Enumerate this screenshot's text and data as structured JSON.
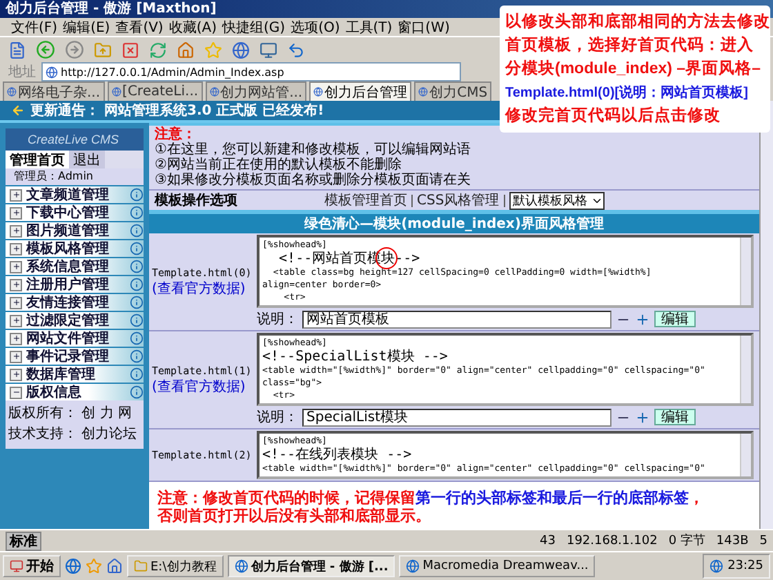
{
  "window": {
    "title": "创力后台管理 - 傲游 [Maxthon]"
  },
  "menu": [
    "文件(F)",
    "编辑(E)",
    "查看(V)",
    "收藏(A)",
    "快捷组(G)",
    "选项(O)",
    "工具(T)",
    "窗口(W)"
  ],
  "address": {
    "label": "地址",
    "value": "http://127.0.0.1/Admin/Admin_Index.asp"
  },
  "tabs": [
    {
      "label": "网络电子杂...",
      "selected": false
    },
    {
      "label": "[CreateLi...",
      "selected": false
    },
    {
      "label": "创力网站管...",
      "selected": false
    },
    {
      "label": "创力后台管理",
      "selected": true
    },
    {
      "label": "创力CMS",
      "selected": false
    }
  ],
  "banner": "更新通告： 网站管理系统3.0 正式版 已经发布!",
  "sidebar": {
    "logo": "CreateLive CMS",
    "tabs": [
      {
        "label": "管理首页",
        "selected": true
      },
      {
        "label": "退出",
        "selected": false
      }
    ],
    "admin": "管理员：Admin",
    "items": [
      {
        "label": "文章频道管理",
        "expanded": false
      },
      {
        "label": "下载中心管理",
        "expanded": false
      },
      {
        "label": "图片频道管理",
        "expanded": false
      },
      {
        "label": "模板风格管理",
        "expanded": false
      },
      {
        "label": "系统信息管理",
        "expanded": false
      },
      {
        "label": "注册用户管理",
        "expanded": false
      },
      {
        "label": "友情连接管理",
        "expanded": false
      },
      {
        "label": "过滤限定管理",
        "expanded": false
      },
      {
        "label": "网站文件管理",
        "expanded": false
      },
      {
        "label": "事件记录管理",
        "expanded": false
      },
      {
        "label": "数据库管理",
        "expanded": false
      },
      {
        "label": "版权信息",
        "expanded": true
      }
    ],
    "footer": [
      "版权所有： 创 力 网",
      "技术支持： 创力论坛"
    ]
  },
  "notice": {
    "title": "注意：",
    "lines": [
      "①在这里，您可以新建和修改模板，可以编辑网站语",
      "②网站当前正在使用的默认模板不能删除",
      "③如果修改分模板页面名称或删除分模板页面请在关"
    ]
  },
  "options": {
    "label": "模板操作选项",
    "links": [
      "模板管理首页",
      "CSS风格管理"
    ],
    "select": "默认模板风格"
  },
  "panel_title": "绿色清心—模块(module_index)界面风格管理",
  "templates": [
    {
      "name": "Template.html(0)",
      "link": "(查看官方数据)",
      "code": [
        "[%showhead%]",
        "  <!--网站首页模块-->",
        "  <table class=bg height=127 cellSpacing=0 cellPadding=0 width=[%width%]",
        "align=center border=0>",
        "    <tr>"
      ],
      "desc_label": "说明：",
      "desc": "网站首页模板",
      "button": "编辑"
    },
    {
      "name": "Template.html(1)",
      "link": "(查看官方数据)",
      "code": [
        "[%showhead%]",
        "<!--SpecialList模块 -->",
        "<table width=\"[%width%]\" border=\"0\" align=\"center\" cellpadding=\"0\" cellspacing=\"0\"",
        "class=\"bg\">",
        "  <tr>"
      ],
      "desc_label": "说明：",
      "desc": "SpecialList模块",
      "button": "编辑"
    },
    {
      "name": "Template.html(2)",
      "code": [
        "[%showhead%]",
        "<!--在线列表模块 -->",
        "<table width=\"[%width%]\" border=\"0\" align=\"center\" cellpadding=\"0\" cellspacing=\"0\""
      ]
    }
  ],
  "callout": [
    {
      "text": "以修改头部和底部相同的方法去修改",
      "highlight": false
    },
    {
      "text": "首页模板，选择好首页代码：进入",
      "highlight": false
    },
    {
      "text": "分模块(module_index) –界面风格–",
      "highlight": false
    },
    {
      "text": "Template.html(0)[说明：网站首页模板]",
      "highlight": true
    },
    {
      "text": "修改完首页代码以后点击修改",
      "highlight": false
    }
  ],
  "note": [
    [
      {
        "text": "注意：修改首页代码的时候，记得保留",
        "highlight": false
      },
      {
        "text": "第一行的头部标签和最后一行的底部标签",
        "highlight": true
      },
      {
        "text": "，",
        "highlight": false
      }
    ],
    [
      {
        "text": "否则首页打开以后没有头部和底部显示。",
        "highlight": false
      }
    ]
  ],
  "status_bar": {
    "mode": "标准",
    "items": [
      "43",
      "192.168.1.102",
      "0 字节",
      "143B",
      "5"
    ]
  },
  "taskbar": {
    "start": "开始",
    "buttons": [
      {
        "label": "E:\\创力教程",
        "selected": false
      },
      {
        "label": "创力后台管理 - 傲游 [...",
        "selected": true
      },
      {
        "label": "Macromedia Dreamweav...",
        "selected": false
      }
    ],
    "clock": "23:25"
  }
}
